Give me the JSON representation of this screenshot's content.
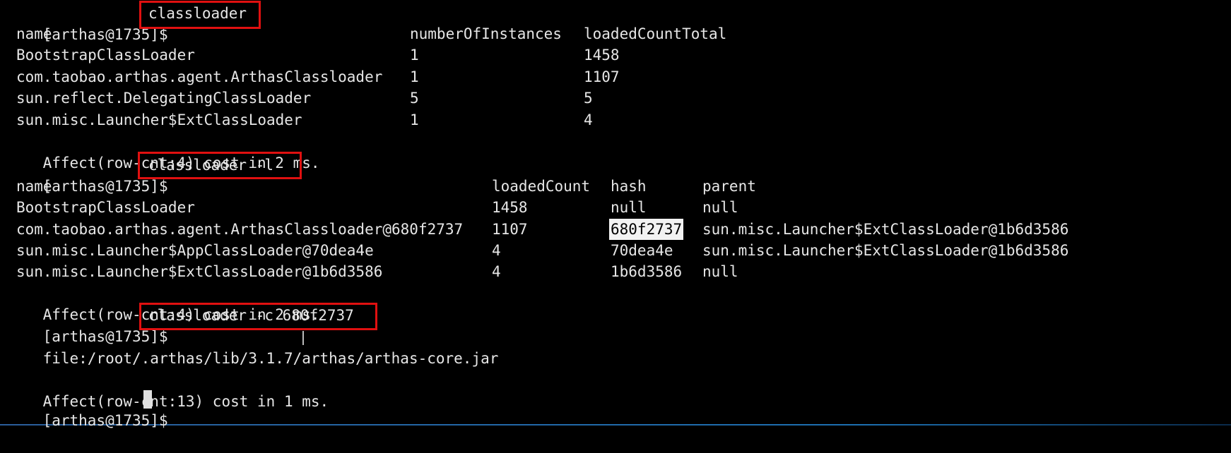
{
  "prompt": "[arthas@1735]$",
  "cmd1": {
    "command": "classloader",
    "headers": [
      "name",
      "numberOfInstances",
      "loadedCountTotal"
    ],
    "rows": [
      [
        "BootstrapClassLoader",
        "1",
        "1458"
      ],
      [
        "com.taobao.arthas.agent.ArthasClassloader",
        "1",
        "1107"
      ],
      [
        "sun.reflect.DelegatingClassLoader",
        "5",
        "5"
      ],
      [
        "sun.misc.Launcher$ExtClassLoader",
        "1",
        "4"
      ]
    ],
    "footer": "Affect(row-cnt:4) cost in 2 ms."
  },
  "cmd2": {
    "command": "classloader -l",
    "headers": [
      "name",
      "loadedCount",
      "hash",
      "parent"
    ],
    "rows": [
      [
        "BootstrapClassLoader",
        "1458",
        "null",
        "null"
      ],
      [
        "com.taobao.arthas.agent.ArthasClassloader@680f2737",
        "1107",
        "680f2737",
        "sun.misc.Launcher$ExtClassLoader@1b6d3586"
      ],
      [
        "sun.misc.Launcher$AppClassLoader@70dea4e",
        "4",
        "70dea4e",
        "sun.misc.Launcher$ExtClassLoader@1b6d3586"
      ],
      [
        "sun.misc.Launcher$ExtClassLoader@1b6d3586",
        "4",
        "1b6d3586",
        "null"
      ]
    ],
    "footer": "Affect(row-cnt:4) cost in 2 ms."
  },
  "cmd3": {
    "command": "classloader -c 680f2737",
    "output": "file:/root/.arthas/lib/3.1.7/arthas/arthas-core.jar",
    "footer": "Affect(row-cnt:13) cost in 1 ms."
  },
  "colors": {
    "background": "#000000",
    "text": "#e6e6e6",
    "highlight_box": "#e01010",
    "selection": "#f2f2f2"
  }
}
